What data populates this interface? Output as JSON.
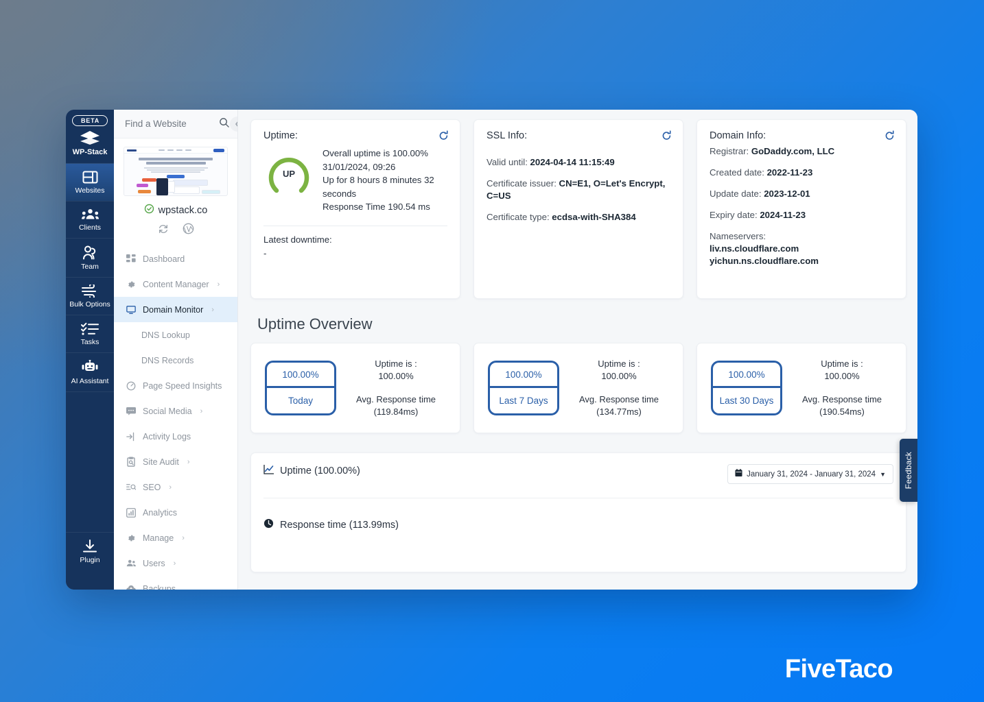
{
  "rail": {
    "beta_badge": "BETA",
    "items": [
      {
        "label": "WP-Stack",
        "icon": "wpstack-logo-icon",
        "active": false
      },
      {
        "label": "Websites",
        "icon": "websites-icon",
        "active": true
      },
      {
        "label": "Clients",
        "icon": "clients-icon",
        "active": false
      },
      {
        "label": "Team",
        "icon": "team-icon",
        "active": false
      },
      {
        "label": "Bulk Options",
        "icon": "bulk-options-icon",
        "active": false
      },
      {
        "label": "Tasks",
        "icon": "tasks-icon",
        "active": false
      },
      {
        "label": "AI Assistant",
        "icon": "ai-assistant-icon",
        "active": false
      }
    ],
    "bottom_item": {
      "label": "Plugin",
      "icon": "plugin-download-icon"
    }
  },
  "sidebar": {
    "search_placeholder": "Find a Website",
    "search_icon": "search-icon",
    "collapse_icon": "chevron-left-icon",
    "site_name": "wpstack.co",
    "site_status_icon": "check-circle-icon",
    "actions": [
      "refresh-icon",
      "wordpress-icon"
    ],
    "nav": [
      {
        "label": "Dashboard",
        "icon": "dashboard-grid-icon",
        "chevron": false,
        "active": false,
        "sub": false
      },
      {
        "label": "Content Manager",
        "icon": "gear-icon",
        "chevron": true,
        "active": false,
        "sub": false
      },
      {
        "label": "Domain Monitor",
        "icon": "monitor-icon",
        "chevron": true,
        "active": true,
        "sub": false
      },
      {
        "label": "DNS Lookup",
        "icon": "",
        "chevron": false,
        "active": false,
        "sub": true
      },
      {
        "label": "DNS Records",
        "icon": "",
        "chevron": false,
        "active": false,
        "sub": true
      },
      {
        "label": "Page Speed Insights",
        "icon": "speedometer-icon",
        "chevron": false,
        "active": false,
        "sub": false
      },
      {
        "label": "Social Media",
        "icon": "chat-icon",
        "chevron": true,
        "active": false,
        "sub": false
      },
      {
        "label": "Activity Logs",
        "icon": "login-arrow-icon",
        "chevron": false,
        "active": false,
        "sub": false
      },
      {
        "label": "Site Audit",
        "icon": "clipboard-search-icon",
        "chevron": true,
        "active": false,
        "sub": false
      },
      {
        "label": "SEO",
        "icon": "seo-search-icon",
        "chevron": true,
        "active": false,
        "sub": false
      },
      {
        "label": "Analytics",
        "icon": "bar-chart-icon",
        "chevron": false,
        "active": false,
        "sub": false
      },
      {
        "label": "Manage",
        "icon": "gear-icon",
        "chevron": true,
        "active": false,
        "sub": false
      },
      {
        "label": "Users",
        "icon": "users-icon",
        "chevron": true,
        "active": false,
        "sub": false
      },
      {
        "label": "Backups",
        "icon": "cloud-upload-icon",
        "chevron": false,
        "active": false,
        "sub": false
      }
    ]
  },
  "uptime_card": {
    "title": "Uptime:",
    "refresh_icon": "refresh-icon",
    "gauge_label": "UP",
    "gauge_color": "#7cb342",
    "line1": "Overall uptime is 100.00%",
    "line2": "31/01/2024, 09:26",
    "line3": "Up for 8 hours 8 minutes 32 seconds",
    "line4": "Response Time 190.54 ms",
    "downtime_label": "Latest downtime:",
    "downtime_value": "-"
  },
  "ssl_card": {
    "title": "SSL Info:",
    "refresh_icon": "refresh-icon",
    "rows": [
      {
        "label": "Valid until: ",
        "value": "2024-04-14 11:15:49"
      },
      {
        "label": "Certificate issuer: ",
        "value": "CN=E1, O=Let's Encrypt, C=US"
      },
      {
        "label": "Certificate type: ",
        "value": "ecdsa-with-SHA384"
      }
    ]
  },
  "domain_card": {
    "title": "Domain Info:",
    "refresh_icon": "refresh-icon",
    "rows": [
      {
        "label": "Registrar: ",
        "value": "GoDaddy.com, LLC"
      },
      {
        "label": "Created date: ",
        "value": "2022-11-23"
      },
      {
        "label": "Update date: ",
        "value": "2023-12-01"
      },
      {
        "label": "Expiry date: ",
        "value": "2024-11-23"
      }
    ],
    "nameservers_label": "Nameservers:",
    "nameservers": [
      "liv.ns.cloudflare.com",
      "yichun.ns.cloudflare.com"
    ]
  },
  "overview": {
    "title": "Uptime Overview",
    "cards": [
      {
        "percent": "100.00%",
        "period": "Today",
        "uptime_label": "Uptime is :",
        "uptime_value": "100.00%",
        "avg_label": "Avg. Response time",
        "avg_value": "(119.84ms)"
      },
      {
        "percent": "100.00%",
        "period": "Last 7 Days",
        "uptime_label": "Uptime is :",
        "uptime_value": "100.00%",
        "avg_label": "Avg. Response time",
        "avg_value": "(134.77ms)"
      },
      {
        "percent": "100.00%",
        "period": "Last 30 Days",
        "uptime_label": "Uptime is :",
        "uptime_value": "100.00%",
        "avg_label": "Avg. Response time",
        "avg_value": "(190.54ms)"
      }
    ]
  },
  "chart_panel": {
    "uptime_title": "Uptime (100.00%)",
    "uptime_icon": "line-chart-icon",
    "date_range": "January 31, 2024 - January 31, 2024",
    "date_icon": "calendar-icon",
    "date_caret": "chevron-down-icon",
    "response_title": "Response time (113.99ms)",
    "response_icon": "clock-icon"
  },
  "feedback_tab": {
    "label": "Feedback"
  },
  "brand": {
    "name": "FiveTaco"
  },
  "colors": {
    "accent_blue": "#2a5fa8",
    "rail_dark": "#16335c",
    "gauge_green": "#7cb342",
    "active_nav_bg": "#e2effb",
    "page_gradient_start": "#5d7590",
    "page_gradient_end": "#0579f5"
  }
}
